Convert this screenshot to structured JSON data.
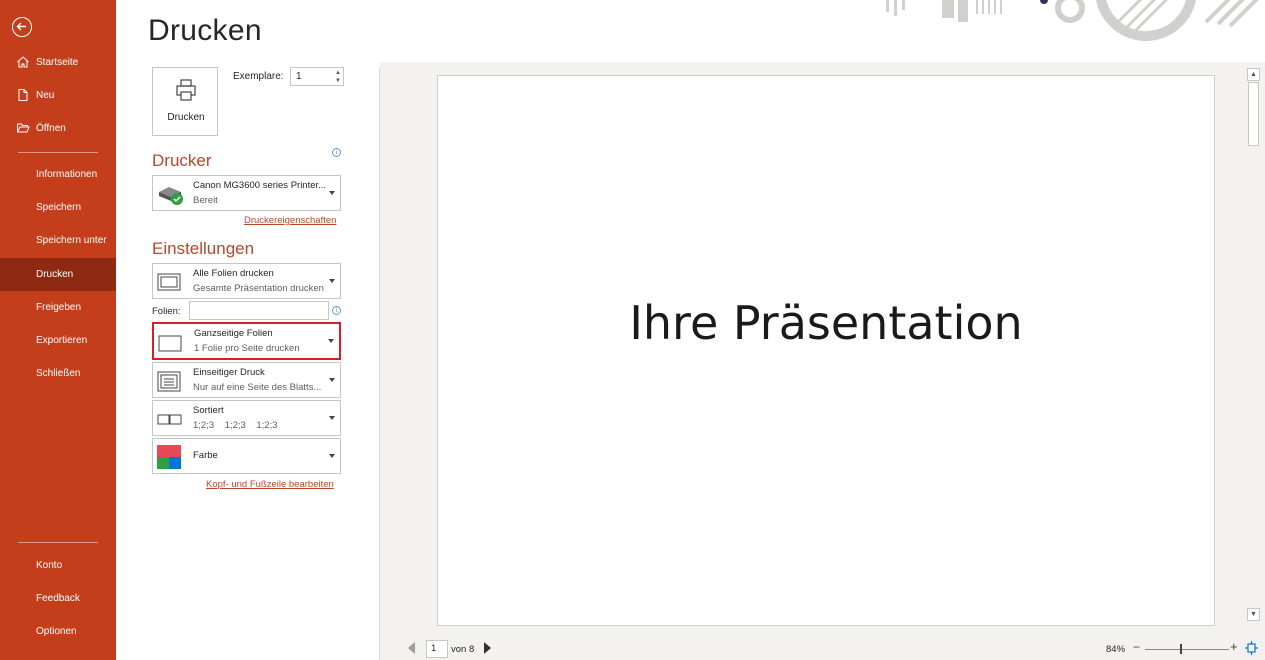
{
  "sidebar": {
    "items": [
      {
        "label": "Startseite"
      },
      {
        "label": "Neu"
      },
      {
        "label": "Öffnen"
      },
      {
        "label": "Informationen"
      },
      {
        "label": "Speichern"
      },
      {
        "label": "Speichern unter"
      },
      {
        "label": "Drucken"
      },
      {
        "label": "Freigeben"
      },
      {
        "label": "Exportieren"
      },
      {
        "label": "Schließen"
      },
      {
        "label": "Konto"
      },
      {
        "label": "Feedback"
      },
      {
        "label": "Optionen"
      }
    ],
    "active": "Drucken"
  },
  "page": {
    "title": "Drucken"
  },
  "print": {
    "button_label": "Drucken",
    "copies_label": "Exemplare:",
    "copies_value": "1"
  },
  "printer": {
    "heading": "Drucker",
    "name": "Canon MG3600 series Printer...",
    "status": "Bereit",
    "properties_link": "Druckereigenschaften"
  },
  "settings": {
    "heading": "Einstellungen",
    "slides_range": {
      "title": "Alle Folien drucken",
      "subtitle": "Gesamte Präsentation drucken"
    },
    "slides_label": "Folien:",
    "slides_value": "",
    "layout": {
      "title": "Ganzseitige Folien",
      "subtitle": "1 Folie pro Seite drucken"
    },
    "sides": {
      "title": "Einseitiger Druck",
      "subtitle": "Nur auf eine Seite des Blatts..."
    },
    "collation": {
      "title": "Sortiert",
      "subtitle": "1;2;3    1;2;3    1;2;3"
    },
    "color": {
      "title": "Farbe"
    },
    "header_footer_link": "Kopf- und Fußzeile bearbeiten"
  },
  "preview": {
    "slide_title": "Ihre Präsentation",
    "current_page": "1",
    "of_label": "von 8",
    "zoom": "84%"
  },
  "colors": {
    "sidebar": "#c43e1c",
    "sidebar_active": "#8e2a12",
    "accent": "#b7472a",
    "highlight_border": "#d41f27"
  }
}
